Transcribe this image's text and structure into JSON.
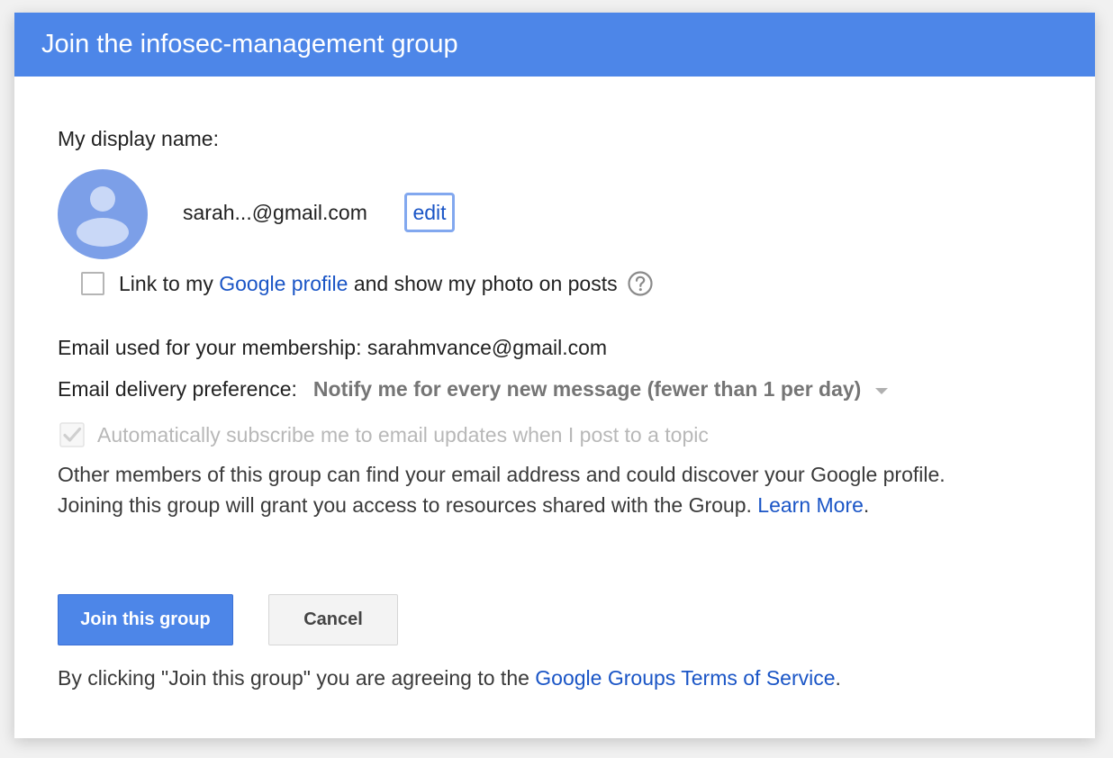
{
  "dialog": {
    "title": "Join the infosec-management group"
  },
  "display_name": {
    "label": "My display name:",
    "value": "sarah...@gmail.com",
    "edit_label": "edit"
  },
  "link_profile": {
    "prefix": "Link to my",
    "link_text": "Google profile",
    "suffix": "and show my photo on posts",
    "checked": false
  },
  "membership": {
    "label": "Email used for your membership:",
    "email": "sarahmvance@gmail.com"
  },
  "delivery": {
    "label": "Email delivery preference:",
    "selected": "Notify me for every new message (fewer than 1 per day)"
  },
  "auto_subscribe": {
    "label": "Automatically subscribe me to email updates when I post to a topic",
    "checked": true,
    "disabled": true
  },
  "info": {
    "text": "Other members of this group can find your email address and could discover your Google profile. Joining this group will grant you access to resources shared with the Group.",
    "link_text": "Learn More",
    "trailing": "."
  },
  "buttons": {
    "join_label": "Join this group",
    "cancel_label": "Cancel"
  },
  "terms": {
    "prefix": "By clicking \"Join this group\" you are agreeing to the",
    "link_text": "Google Groups Terms of Service",
    "suffix": "."
  },
  "colors": {
    "header": "#4d86e8",
    "link": "#1a55c6",
    "primary_button": "#4d86e8"
  },
  "icons": {
    "avatar": "default-avatar-icon",
    "help": "help-circle-icon",
    "dropdown": "caret-down-icon",
    "check": "checkmark-icon"
  }
}
